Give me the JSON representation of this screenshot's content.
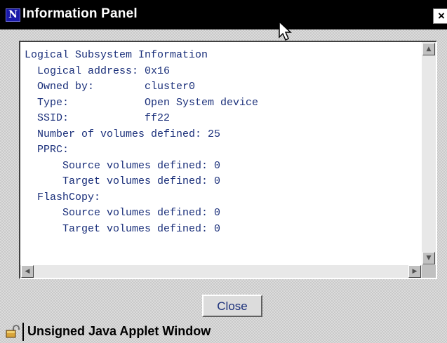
{
  "window": {
    "title": "Information Panel",
    "app_icon_letter": "N",
    "close_glyph": "×"
  },
  "info": {
    "lines": [
      "Logical Subsystem Information",
      "  Logical address: 0x16",
      "  Owned by:        cluster0",
      "  Type:            Open System device",
      "  SSID:            ff22",
      "  Number of volumes defined: 25",
      "  PPRC:",
      "      Source volumes defined: 0",
      "      Target volumes defined: 0",
      "  FlashCopy:",
      "      Source volumes defined: 0",
      "      Target volumes defined: 0"
    ]
  },
  "buttons": {
    "close_label": "Close"
  },
  "statusbar": {
    "text": "Unsigned Java Applet Window"
  },
  "icons": {
    "app": "netscape-n-icon",
    "close": "close-icon",
    "cursor": "mouse-pointer-icon",
    "scroll_up": "scroll-up-arrow-icon",
    "scroll_down": "scroll-down-arrow-icon",
    "scroll_left": "scroll-left-arrow-icon",
    "scroll_right": "scroll-right-arrow-icon",
    "status": "unlocked-padlock-icon"
  },
  "colors": {
    "text": "#1a2f7a",
    "titlebar": "#000000",
    "window_bg": "#c9c9c9"
  }
}
